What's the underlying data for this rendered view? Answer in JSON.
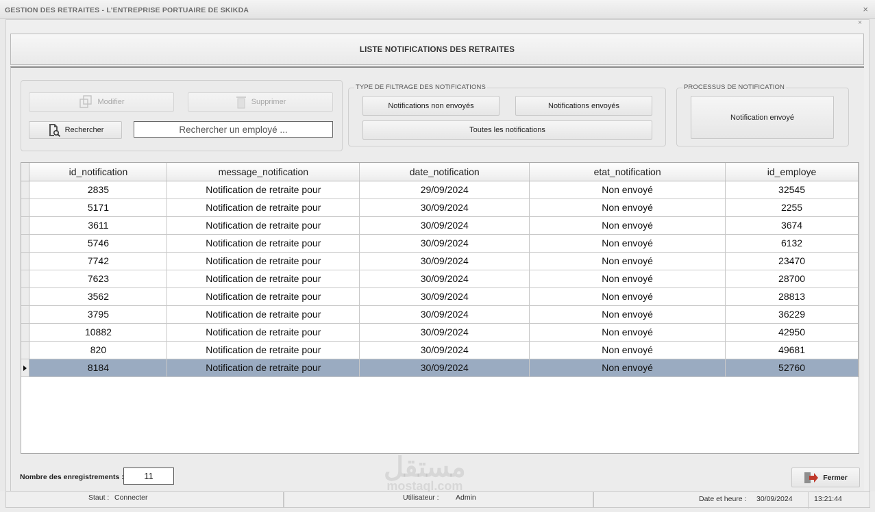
{
  "window": {
    "title": "GESTION DES RETRAITES - L'ENTREPRISE PORTUAIRE DE SKIKDA",
    "close_glyph": "×"
  },
  "header": {
    "title": "LISTE NOTIFICATIONS DES RETRAITES"
  },
  "actions": {
    "modify_label": "Modifier",
    "delete_label": "Supprimer",
    "search_label": "Rechercher",
    "search_value": "Rechercher un employé ..."
  },
  "filter_group": {
    "legend": "TYPE DE FILTRAGE DES NOTIFICATIONS",
    "not_sent_label": "Notifications non envoyés",
    "sent_label": "Notifications envoyés",
    "all_label": "Toutes les notifications"
  },
  "process_group": {
    "legend": "PROCESSUS DE NOTIFICATION",
    "sent_button_label": "Notification envoyé"
  },
  "table": {
    "columns": [
      "id_notification",
      "message_notification",
      "date_notification",
      "etat_notification",
      "id_employe"
    ],
    "rows": [
      [
        "2835",
        "Notification de retraite pour",
        "29/09/2024",
        "Non envoyé",
        "32545"
      ],
      [
        "5171",
        "Notification de retraite pour",
        "30/09/2024",
        "Non envoyé",
        "2255"
      ],
      [
        "3611",
        "Notification de retraite pour",
        "30/09/2024",
        "Non envoyé",
        "3674"
      ],
      [
        "5746",
        "Notification de retraite pour",
        "30/09/2024",
        "Non envoyé",
        "6132"
      ],
      [
        "7742",
        "Notification de retraite pour",
        "30/09/2024",
        "Non envoyé",
        "23470"
      ],
      [
        "7623",
        "Notification de retraite pour",
        "30/09/2024",
        "Non envoyé",
        "28700"
      ],
      [
        "3562",
        "Notification de retraite pour",
        "30/09/2024",
        "Non envoyé",
        "28813"
      ],
      [
        "3795",
        "Notification de retraite pour",
        "30/09/2024",
        "Non envoyé",
        "36229"
      ],
      [
        "10882",
        "Notification de retraite pour",
        "30/09/2024",
        "Non envoyé",
        "42950"
      ],
      [
        "820",
        "Notification de retraite pour",
        "30/09/2024",
        "Non envoyé",
        "49681"
      ],
      [
        "8184",
        "Notification de retraite pour",
        "30/09/2024",
        "Non envoyé",
        "52760"
      ]
    ],
    "selected_row": 10,
    "selected_color": "#9aabc1"
  },
  "footer": {
    "count_label": "Nombre des enregistrements :",
    "count_value": "11",
    "close_label": "Fermer"
  },
  "statusbar": {
    "status_label": "Staut :",
    "status_value": "Connecter",
    "user_label": "Utilisateur :",
    "user_value": "Admin",
    "datetime_label": "Date et heure :",
    "date_value": "30/09/2024",
    "time_value": "13:21:44"
  },
  "watermark": {
    "text": "مستقل",
    "sub": "mostaql.com"
  },
  "icons": [
    "edit-icon",
    "trash-icon",
    "search-document-icon",
    "exit-arrow-icon"
  ]
}
